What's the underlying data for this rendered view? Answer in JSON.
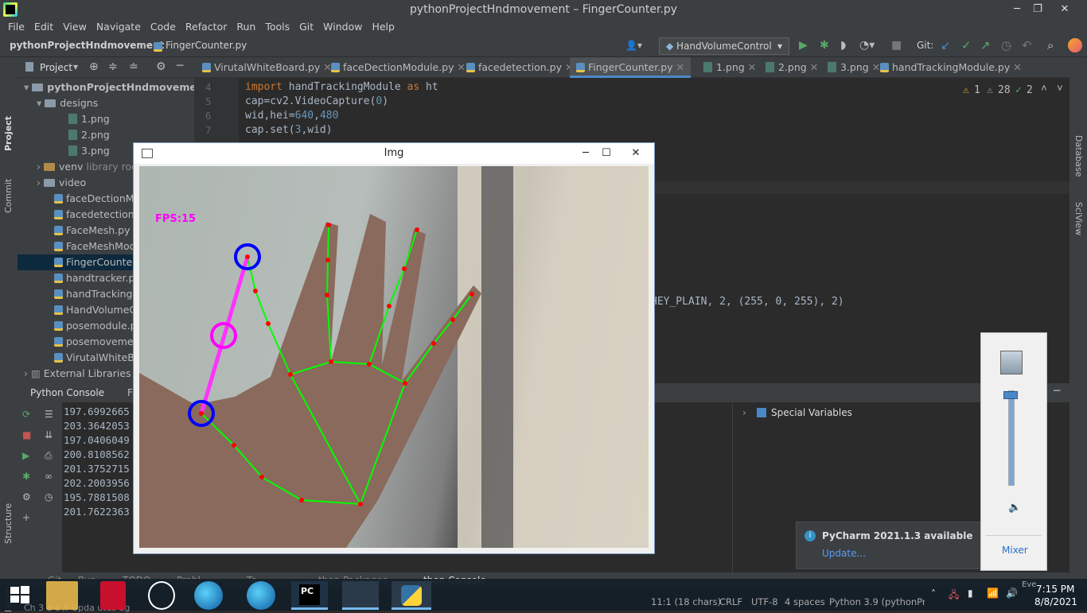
{
  "window": {
    "title": "pythonProjectHndmovement – FingerCounter.py"
  },
  "menu": [
    "File",
    "Edit",
    "View",
    "Navigate",
    "Code",
    "Refactor",
    "Run",
    "Tools",
    "Git",
    "Window",
    "Help"
  ],
  "breadcrumb": {
    "project": "pythonProjectHndmovement",
    "file": "FingerCounter.py"
  },
  "toolbar": {
    "run_config": "HandVolumeControl",
    "git_label": "Git:"
  },
  "project_panel": {
    "title": "Project",
    "root": "pythonProjectHndmovement",
    "items": [
      {
        "label": "designs",
        "kind": "folder"
      },
      {
        "label": "1.png",
        "kind": "png"
      },
      {
        "label": "2.png",
        "kind": "png"
      },
      {
        "label": "3.png",
        "kind": "png"
      },
      {
        "label": "venv",
        "kind": "folder",
        "hint": "library roo"
      },
      {
        "label": "video",
        "kind": "folder"
      },
      {
        "label": "faceDectionMod",
        "kind": "py"
      },
      {
        "label": "facedetection.py",
        "kind": "py"
      },
      {
        "label": "FaceMesh.py",
        "kind": "py"
      },
      {
        "label": "FaceMeshModu",
        "kind": "py"
      },
      {
        "label": "FingerCounter.p",
        "kind": "py",
        "selected": true
      },
      {
        "label": "handtracker.py",
        "kind": "py"
      },
      {
        "label": "handTrackingM",
        "kind": "py"
      },
      {
        "label": "HandVolumeCo",
        "kind": "py"
      },
      {
        "label": "posemodule.py",
        "kind": "py"
      },
      {
        "label": "posemovement",
        "kind": "py"
      },
      {
        "label": "VirutalWhiteBoa",
        "kind": "py"
      }
    ],
    "external": "External Libraries"
  },
  "tabs": [
    "VirutalWhiteBoard.py",
    "faceDectionModule.py",
    "facedetection.py",
    "FingerCounter.py",
    "1.png",
    "2.png",
    "3.png",
    "handTrackingModule.py"
  ],
  "active_tab": "FingerCounter.py",
  "inspections": {
    "warnings": "1",
    "weak": "28",
    "ok": "2"
  },
  "code": {
    "lines": [
      {
        "n": "4",
        "kw": "import ",
        "rest": "handTrackingModule ",
        "kw2": "as ",
        "rest2": "ht"
      },
      {
        "n": "5",
        "text": "cap=cv2.VideoCapture(",
        "num": "0",
        "end": ")"
      },
      {
        "n": "6",
        "text": "wid,hei=",
        "num": "640",
        "mid": ",",
        "num2": "480"
      },
      {
        "n": "7",
        "text": "cap.set(",
        "num": "3",
        "end": ",wid)"
      }
    ],
    "partial": "HEY_PLAIN, 2, (255, 0, 255), 2)"
  },
  "console": {
    "tab": "Python Console",
    "tab2": "F",
    "values": [
      "197.6992665",
      "203.3642053",
      "197.0406049",
      "200.8108562",
      "201.3752715",
      "202.2003956",
      "195.7881508",
      "201.7622363"
    ],
    "special": "Special Variables"
  },
  "img_window": {
    "title": "Img",
    "fps": "FPS:15"
  },
  "notification": {
    "title": "PyCharm 2021.1.3 available",
    "link": "Update..."
  },
  "mixer": {
    "label": "Mixer",
    "level": 0.95
  },
  "status": {
    "position": "11:1 (18 chars)",
    "crlf": "CRLF",
    "encoding": "UTF-8",
    "indent": "4 spaces",
    "interpreter": "Python 3.9 (pythonProjectHndmovement)",
    "bottom_tabs": [
      "Git",
      "Run",
      "TODO",
      "Probl",
      "Te",
      "thon Packages",
      "thon Console"
    ],
    "bottom_msg": "Ch           3 a        e // Upda         utes ag"
  },
  "clock": {
    "time": "7:15 PM",
    "date": "8/8/2021",
    "events": "Eve"
  },
  "colors": {
    "accent": "#4a88c7",
    "landmark": "#ff0000",
    "connection": "#00ff00",
    "fps": "#ff00ff"
  }
}
